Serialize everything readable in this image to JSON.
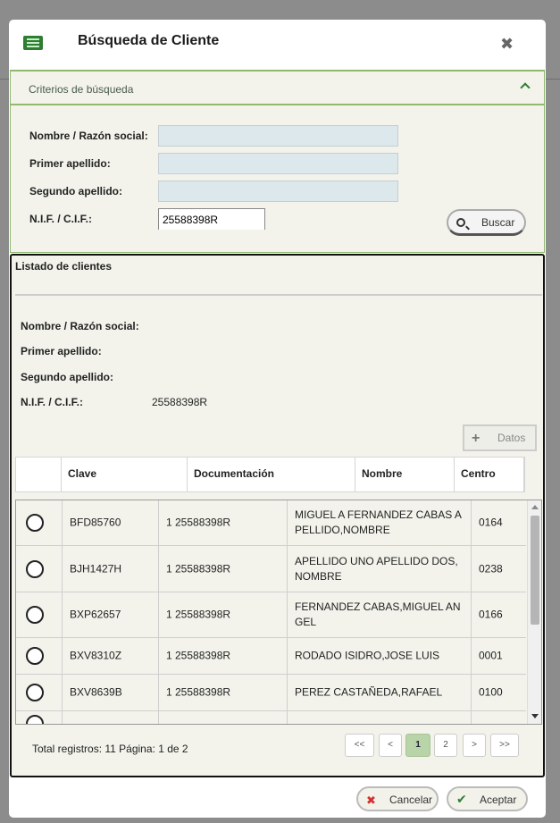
{
  "dialog": {
    "title": "Búsqueda de Cliente",
    "header_icon": "list-icon",
    "close_icon": "close-icon"
  },
  "criteria": {
    "title": "Criterios de búsqueda",
    "fields": [
      {
        "label": "Nombre / Razón social:",
        "value": ""
      },
      {
        "label": "Primer apellido:",
        "value": ""
      },
      {
        "label": "Segundo apellido:",
        "value": ""
      },
      {
        "label": "N.I.F. / C.I.F.:",
        "value": "25588398R"
      }
    ],
    "search_label": "Buscar"
  },
  "results": {
    "title": "Listado de clientes",
    "summary": [
      {
        "label": "Nombre / Razón social:",
        "value": ""
      },
      {
        "label": "Primer apellido:",
        "value": ""
      },
      {
        "label": "Segundo apellido:",
        "value": ""
      },
      {
        "label": "N.I.F. / C.I.F.:",
        "value": "25588398R"
      }
    ],
    "datos_label": "Datos",
    "columns": [
      "",
      "Clave",
      "Documentación",
      "Nombre",
      "Centro"
    ],
    "rows": [
      {
        "clave": "BFD85760",
        "doc": "1 25588398R",
        "nombre": "MIGUEL A FERNANDEZ CABAS A PELLIDO,NOMBRE",
        "centro": "0164"
      },
      {
        "clave": "BJH1427H",
        "doc": "1 25588398R",
        "nombre": "APELLIDO UNO APELLIDO DOS, NOMBRE",
        "centro": "0238"
      },
      {
        "clave": "BXP62657",
        "doc": "1 25588398R",
        "nombre": "FERNANDEZ CABAS,MIGUEL AN GEL",
        "centro": "0166"
      },
      {
        "clave": "BXV8310Z",
        "doc": "1 25588398R",
        "nombre": "RODADO ISIDRO,JOSE LUIS",
        "centro": "0001"
      },
      {
        "clave": "BXV8639B",
        "doc": "1 25588398R",
        "nombre": "PEREZ CASTAÑEDA,RAFAEL",
        "centro": "0100"
      }
    ],
    "total_text": "Total registros: 11 Página: 1 de 2",
    "pager": [
      "<<",
      "<",
      "1",
      "2",
      ">",
      ">>"
    ],
    "current_page": "1"
  },
  "footer": {
    "cancel_label": "Cancelar",
    "accept_label": "Aceptar"
  },
  "colors": {
    "accent_green": "#8fb96f",
    "input_bg": "#dde8ec",
    "active_page": "#b9d4a8",
    "cancel_red": "#d32f2f",
    "accept_green": "#2e7d32"
  }
}
